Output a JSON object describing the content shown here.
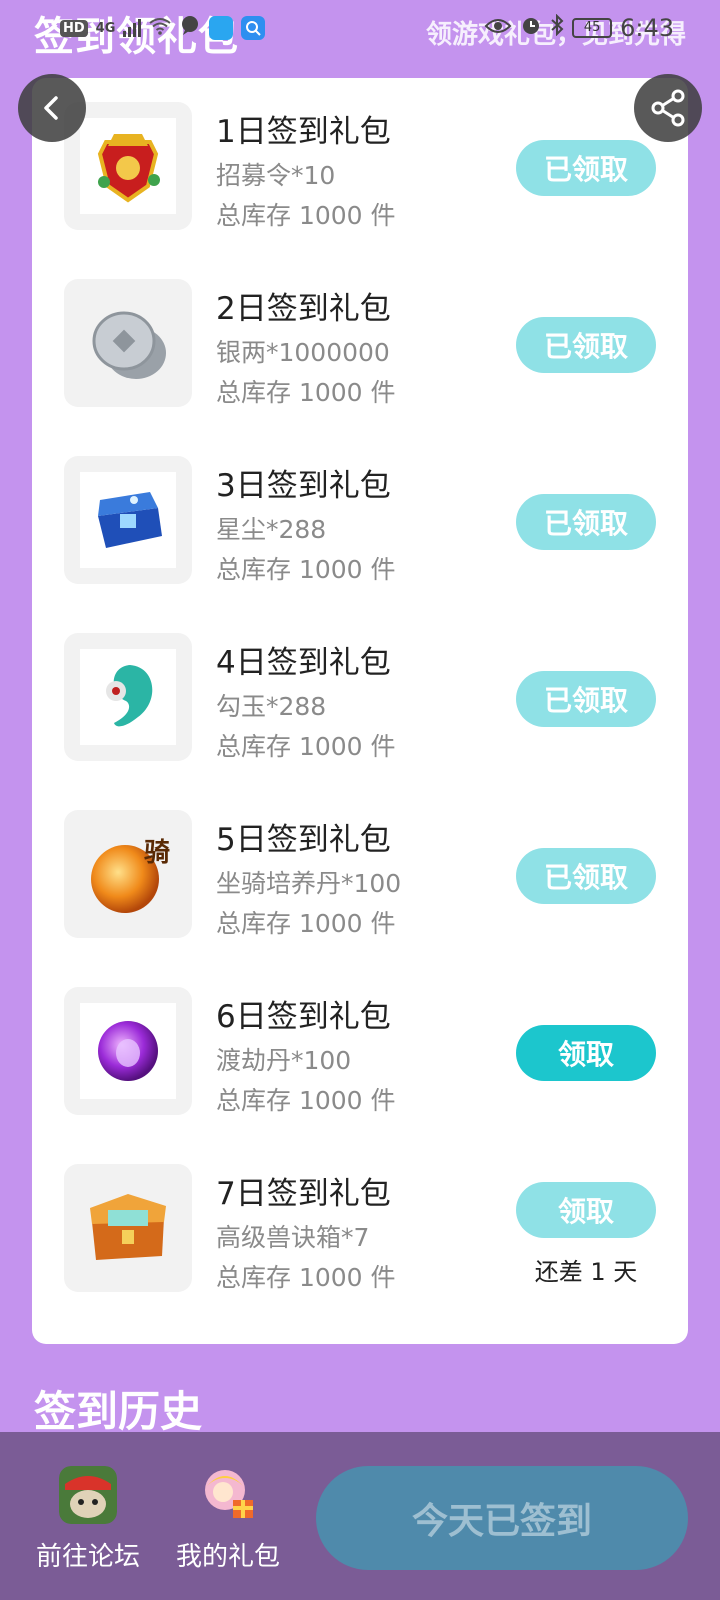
{
  "header": {
    "title": "签到领礼包",
    "subtitle": "领游戏礼包，见到先得"
  },
  "status_bar": {
    "network": "HD",
    "signal": "4G",
    "battery": "45",
    "time": "6:43"
  },
  "gifts": [
    {
      "name": "1日签到礼包",
      "item": "招募令*10",
      "stock": "总库存 1000 件",
      "button": "已领取",
      "state": "claimed",
      "icon": "recruit-token-icon"
    },
    {
      "name": "2日签到礼包",
      "item": "银两*1000000",
      "stock": "总库存 1000 件",
      "button": "已领取",
      "state": "claimed",
      "icon": "silver-coins-icon"
    },
    {
      "name": "3日签到礼包",
      "item": "星尘*288",
      "stock": "总库存 1000 件",
      "button": "已领取",
      "state": "claimed",
      "icon": "stardust-chest-icon"
    },
    {
      "name": "4日签到礼包",
      "item": "勾玉*288",
      "stock": "总库存 1000 件",
      "button": "已领取",
      "state": "claimed",
      "icon": "magatama-icon"
    },
    {
      "name": "5日签到礼包",
      "item": "坐骑培养丹*100",
      "stock": "总库存 1000 件",
      "button": "已领取",
      "state": "claimed",
      "icon": "mount-pill-icon",
      "badge": "骑"
    },
    {
      "name": "6日签到礼包",
      "item": "渡劫丹*100",
      "stock": "总库存 1000 件",
      "button": "领取",
      "state": "available",
      "icon": "tribulation-pill-icon"
    },
    {
      "name": "7日签到礼包",
      "item": "高级兽诀箱*7",
      "stock": "总库存 1000 件",
      "button": "领取",
      "state": "locked",
      "note": "还差 1 天",
      "icon": "beast-chest-icon"
    }
  ],
  "history": {
    "title": "签到历史"
  },
  "bottom_bar": {
    "forum_label": "前往论坛",
    "my_gifts_label": "我的礼包",
    "signin_label": "今天已签到"
  },
  "colors": {
    "background": "#c493ee",
    "claimed_button": "#8fe1e6",
    "active_button": "#1cc6cd",
    "bottom_bar": "#7b5c96",
    "signin_button": "#4f8aab"
  }
}
